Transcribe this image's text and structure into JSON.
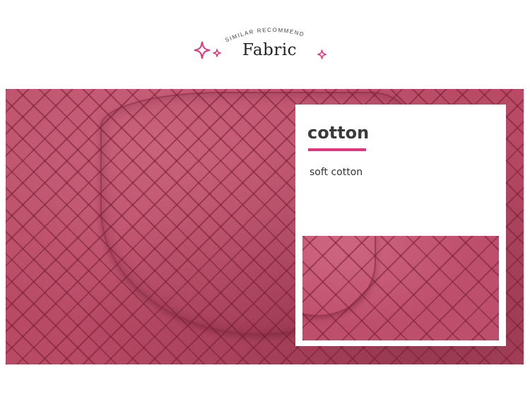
{
  "header": {
    "arc_text": "SIMILAR RECOMMEND",
    "title": "Fabric",
    "accent_color": "#e0357a"
  },
  "card": {
    "title": "cotton",
    "description": "soft cotton"
  }
}
